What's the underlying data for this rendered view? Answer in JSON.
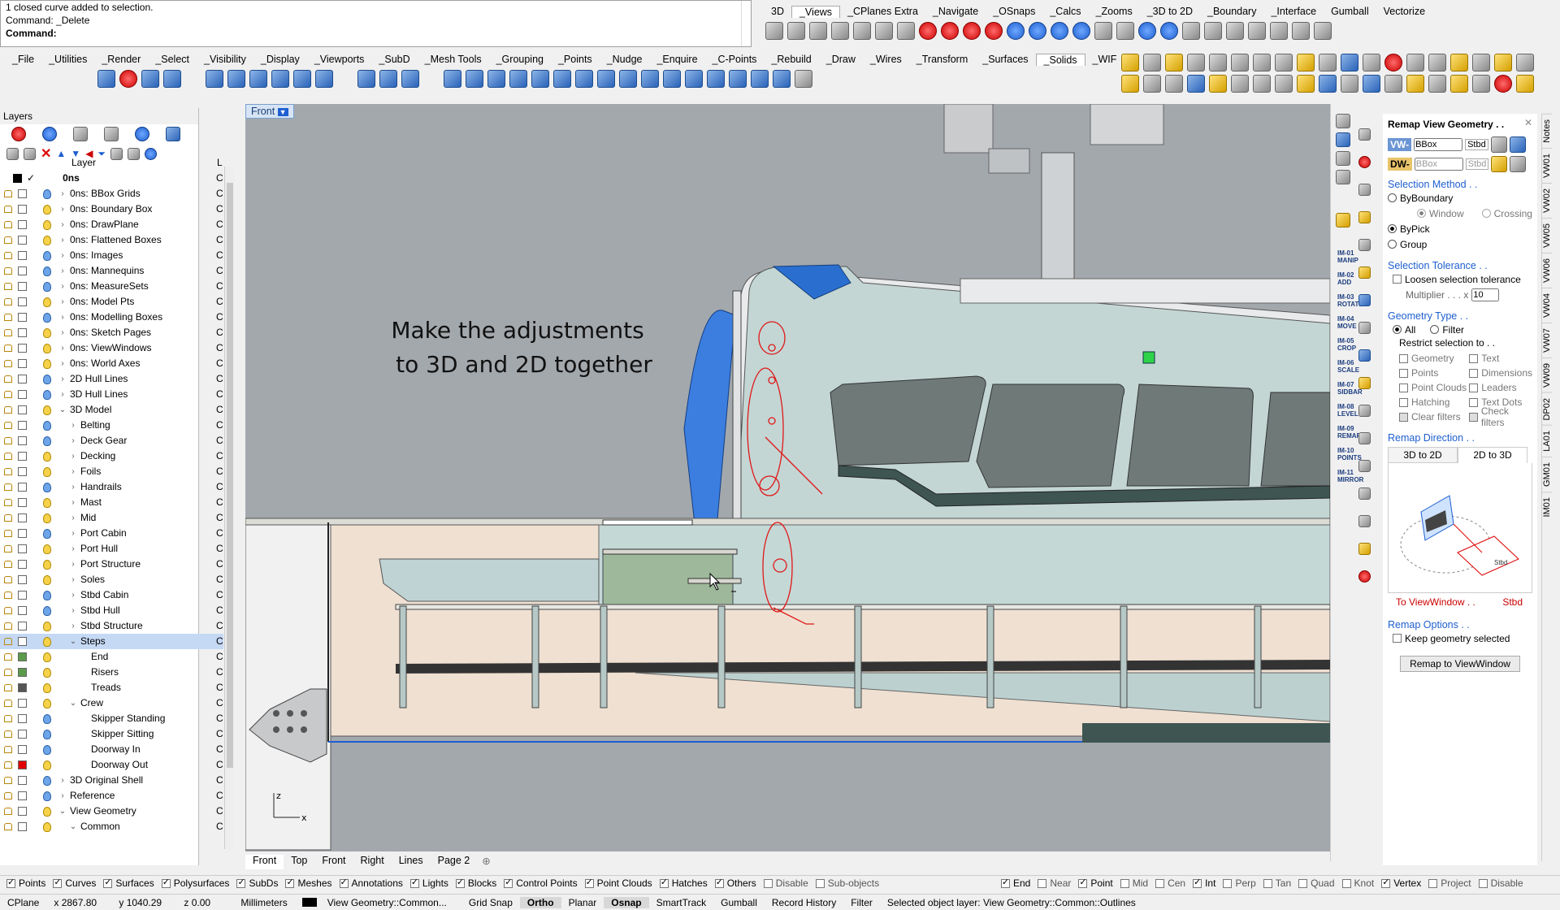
{
  "command": {
    "history": [
      "1 closed curve added to selection.",
      "Command: _Delete"
    ],
    "prompt_label": "Command:",
    "input_value": ""
  },
  "top_tabs": [
    "3D",
    "_Views",
    "_CPlanes Extra",
    "_Navigate",
    "_OSnaps",
    "_Calcs",
    "_Zooms",
    "_3D to 2D",
    "_Boundary",
    "_Interface",
    "Gumball",
    "Vectorize"
  ],
  "main_tabs": [
    "_File",
    "_Utilities",
    "_Render",
    "_Select",
    "_Visibility",
    "_Display",
    "_Viewports",
    "_SubD",
    "_Mesh Tools",
    "_Grouping",
    "_Points",
    "_Nudge",
    "_Enquire",
    "_C-Points",
    "_Rebuild",
    "_Draw",
    "_Wires",
    "_Transform",
    "_Surfaces",
    "_Solids",
    "_WIF"
  ],
  "layers_panel": {
    "title": "Layers",
    "column_layer": "Layer",
    "column_l": "L",
    "rows": [
      {
        "name": "0ns",
        "indent": 0,
        "caret": "",
        "bold": true,
        "swatch": "#000000",
        "current": true
      },
      {
        "name": "0ns: BBox Grids",
        "indent": 1,
        "caret": "›",
        "bulb": "blue"
      },
      {
        "name": "0ns: Boundary Box",
        "indent": 1,
        "caret": "›",
        "bulb": "yellow"
      },
      {
        "name": "0ns: DrawPlane",
        "indent": 1,
        "caret": "›",
        "bulb": "yellow"
      },
      {
        "name": "0ns: Flattened Boxes",
        "indent": 1,
        "caret": "›",
        "bulb": "yellow"
      },
      {
        "name": "0ns: Images",
        "indent": 1,
        "caret": "›",
        "bulb": "blue"
      },
      {
        "name": "0ns: Mannequins",
        "indent": 1,
        "caret": "›",
        "bulb": "blue"
      },
      {
        "name": "0ns: MeasureSets",
        "indent": 1,
        "caret": "›",
        "bulb": "blue"
      },
      {
        "name": "0ns: Model Pts",
        "indent": 1,
        "caret": "›",
        "bulb": "yellow"
      },
      {
        "name": "0ns: Modelling Boxes",
        "indent": 1,
        "caret": "›",
        "bulb": "blue"
      },
      {
        "name": "0ns: Sketch Pages",
        "indent": 1,
        "caret": "›",
        "bulb": "yellow"
      },
      {
        "name": "0ns: ViewWindows",
        "indent": 1,
        "caret": "›",
        "bulb": "yellow"
      },
      {
        "name": "0ns: World Axes",
        "indent": 1,
        "caret": "›",
        "bulb": "yellow"
      },
      {
        "name": "2D Hull Lines",
        "indent": 1,
        "caret": "›",
        "bulb": "blue"
      },
      {
        "name": "3D Hull Lines",
        "indent": 1,
        "caret": "›",
        "bulb": "blue"
      },
      {
        "name": "3D Model",
        "indent": 1,
        "caret": "⌄",
        "bulb": "yellow"
      },
      {
        "name": "Belting",
        "indent": 2,
        "caret": "›",
        "bulb": "blue"
      },
      {
        "name": "Deck Gear",
        "indent": 2,
        "caret": "›",
        "bulb": "blue"
      },
      {
        "name": "Decking",
        "indent": 2,
        "caret": "›",
        "bulb": "yellow"
      },
      {
        "name": "Foils",
        "indent": 2,
        "caret": "›",
        "bulb": "yellow"
      },
      {
        "name": "Handrails",
        "indent": 2,
        "caret": "›",
        "bulb": "blue"
      },
      {
        "name": "Mast",
        "indent": 2,
        "caret": "›",
        "bulb": "yellow"
      },
      {
        "name": "Mid",
        "indent": 2,
        "caret": "›",
        "bulb": "yellow"
      },
      {
        "name": "Port Cabin",
        "indent": 2,
        "caret": "›",
        "bulb": "blue"
      },
      {
        "name": "Port Hull",
        "indent": 2,
        "caret": "›",
        "bulb": "yellow"
      },
      {
        "name": "Port Structure",
        "indent": 2,
        "caret": "›",
        "bulb": "yellow"
      },
      {
        "name": "Soles",
        "indent": 2,
        "caret": "›",
        "bulb": "yellow"
      },
      {
        "name": "Stbd Cabin",
        "indent": 2,
        "caret": "›",
        "bulb": "blue"
      },
      {
        "name": "Stbd Hull",
        "indent": 2,
        "caret": "›",
        "bulb": "blue"
      },
      {
        "name": "Stbd Structure",
        "indent": 2,
        "caret": "›",
        "bulb": "yellow"
      },
      {
        "name": "Steps",
        "indent": 2,
        "caret": "⌄",
        "bulb": "yellow",
        "selected": true
      },
      {
        "name": "End",
        "indent": 3,
        "caret": "",
        "bulb": "yellow",
        "swatch": "#5a9a4a"
      },
      {
        "name": "Risers",
        "indent": 3,
        "caret": "",
        "bulb": "yellow",
        "swatch": "#5a9a4a"
      },
      {
        "name": "Treads",
        "indent": 3,
        "caret": "",
        "bulb": "yellow",
        "swatch": "#555555"
      },
      {
        "name": "Crew",
        "indent": 2,
        "caret": "⌄",
        "bulb": "yellow"
      },
      {
        "name": "Skipper Standing",
        "indent": 3,
        "caret": "",
        "bulb": "blue"
      },
      {
        "name": "Skipper Sitting",
        "indent": 3,
        "caret": "",
        "bulb": "blue"
      },
      {
        "name": "Doorway In",
        "indent": 3,
        "caret": "",
        "bulb": "blue"
      },
      {
        "name": "Doorway Out",
        "indent": 3,
        "caret": "",
        "bulb": "yellow",
        "swatch": "#e00000"
      },
      {
        "name": "3D Original Shell",
        "indent": 1,
        "caret": "›",
        "bulb": "blue"
      },
      {
        "name": "Reference",
        "indent": 1,
        "caret": "›",
        "bulb": "blue"
      },
      {
        "name": "View Geometry",
        "indent": 1,
        "caret": "⌄",
        "bulb": "yellow"
      },
      {
        "name": "Common",
        "indent": 2,
        "caret": "⌄",
        "bulb": "yellow"
      }
    ]
  },
  "viewport": {
    "name": "Front",
    "annotation_line1": "Make the adjustments",
    "annotation_line2": "to 3D and 2D together",
    "axis_z": "z",
    "axis_x": "x"
  },
  "viewport_tabs": [
    "Front",
    "Top",
    "Front",
    "Right",
    "Lines",
    "Page 2"
  ],
  "side_buttons": [
    "IM-01 MANIP",
    "IM-02 ADD",
    "IM-03 ROTATE",
    "IM-04 MOVE",
    "IM-05 CROP",
    "IM-06 SCALE",
    "IM-07 SIDBAR",
    "IM-08 LEVEL",
    "IM-09 REMAP",
    "IM-10 POINTS",
    "IM-11 MIRROR"
  ],
  "remap_panel": {
    "title": "Remap View Geometry . .",
    "vw_label": "VW-",
    "vw_value": "BBox",
    "vw_side": "Stbd",
    "dw_label": "DW-",
    "dw_value": "BBox",
    "dw_side": "Stbd",
    "selection_method_head": "Selection Method . .",
    "by_boundary": "ByBoundary",
    "window": "Window",
    "crossing": "Crossing",
    "by_pick": "ByPick",
    "group": "Group",
    "tolerance_head": "Selection Tolerance . .",
    "loosen": "Loosen selection tolerance",
    "multiplier_label": "Multiplier . . . x",
    "multiplier_value": "10",
    "geometry_type_head": "Geometry Type . .",
    "all": "All",
    "filter": "Filter",
    "restrict": "Restrict selection to . .",
    "types_left": [
      "Geometry",
      "Points",
      "Point Clouds",
      "Hatching",
      "Clear filters"
    ],
    "types_right": [
      "Text",
      "Dimensions",
      "Leaders",
      "Text Dots",
      "Check filters"
    ],
    "remap_direction_head": "Remap Direction . .",
    "tab_3d_to_2d": "3D to 2D",
    "tab_2d_to_3d": "2D to 3D",
    "diagram_label": "Stbd",
    "to_viewwindow": "To ViewWindow . .",
    "to_side": "Stbd",
    "remap_options_head": "Remap Options . .",
    "keep_selected": "Keep geometry selected",
    "remap_button": "Remap to ViewWindow"
  },
  "right_vtabs": [
    "Notes",
    "VW01",
    "VW02",
    "VW05",
    "VW06",
    "VW04",
    "VW07",
    "VW09",
    "DP02",
    "LA01",
    "GM01",
    "IM01"
  ],
  "filter_bar": [
    {
      "label": "Points",
      "checked": true
    },
    {
      "label": "Curves",
      "checked": true
    },
    {
      "label": "Surfaces",
      "checked": true
    },
    {
      "label": "Polysurfaces",
      "checked": true
    },
    {
      "label": "SubDs",
      "checked": true
    },
    {
      "label": "Meshes",
      "checked": true
    },
    {
      "label": "Annotations",
      "checked": true
    },
    {
      "label": "Lights",
      "checked": true
    },
    {
      "label": "Blocks",
      "checked": true
    },
    {
      "label": "Control Points",
      "checked": true
    },
    {
      "label": "Point Clouds",
      "checked": true
    },
    {
      "label": "Hatches",
      "checked": true
    },
    {
      "label": "Others",
      "checked": true
    },
    {
      "label": "Disable",
      "checked": false
    },
    {
      "label": "Sub-objects",
      "checked": false
    }
  ],
  "osnap_bar": [
    {
      "label": "End",
      "checked": true
    },
    {
      "label": "Near",
      "checked": false
    },
    {
      "label": "Point",
      "checked": true
    },
    {
      "label": "Mid",
      "checked": false
    },
    {
      "label": "Cen",
      "checked": false
    },
    {
      "label": "Int",
      "checked": true
    },
    {
      "label": "Perp",
      "checked": false
    },
    {
      "label": "Tan",
      "checked": false
    },
    {
      "label": "Quad",
      "checked": false
    },
    {
      "label": "Knot",
      "checked": false
    },
    {
      "label": "Vertex",
      "checked": true
    },
    {
      "label": "Project",
      "checked": false
    },
    {
      "label": "Disable",
      "checked": false
    }
  ],
  "status": {
    "cplane": "CPlane",
    "x": "x 2867.80",
    "y": "y 1040.29",
    "z": "z 0.00",
    "units": "Millimeters",
    "layer": "View Geometry::Common...",
    "grid_snap": "Grid Snap",
    "ortho": "Ortho",
    "planar": "Planar",
    "osnap": "Osnap",
    "smarttrack": "SmartTrack",
    "gumball": "Gumball",
    "record_history": "Record History",
    "filter": "Filter",
    "message": "Selected object layer: View Geometry::Common::Outlines"
  }
}
